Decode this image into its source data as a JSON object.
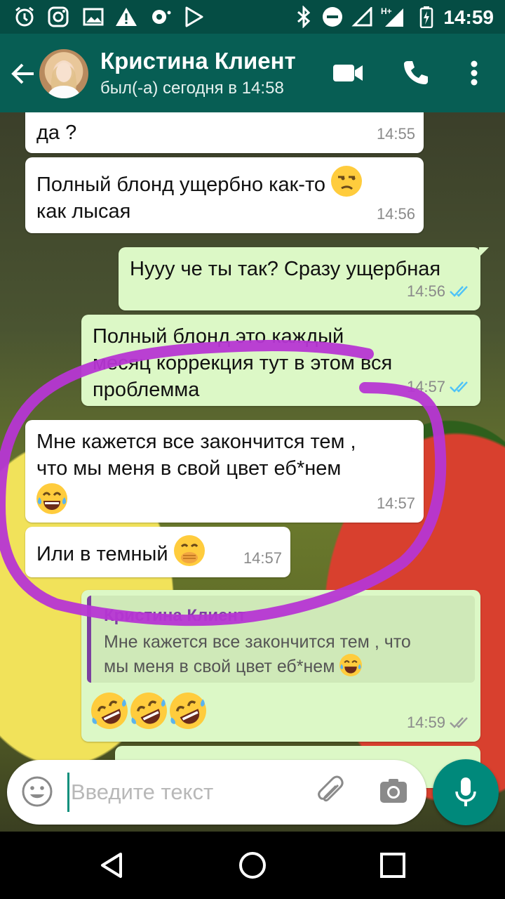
{
  "status_bar": {
    "time": "14:59",
    "network_label": "H+",
    "icons": [
      "alarm-icon",
      "instagram-icon",
      "gallery-icon",
      "warning-icon",
      "sync-icon",
      "play-store-icon",
      "bluetooth-icon",
      "do-not-disturb-icon",
      "signal-icon",
      "battery-icon"
    ]
  },
  "header": {
    "contact_name": "Кристина Клиент",
    "last_seen": "был(-а) сегодня в 14:58",
    "icons": [
      "back-arrow-icon",
      "avatar",
      "video-call-icon",
      "phone-icon",
      "more-vert-icon"
    ]
  },
  "messages": [
    {
      "dir": "in",
      "text": "будут, надо будет несколько раз , да ?",
      "visible_text": "да ?",
      "time": "14:55"
    },
    {
      "dir": "in",
      "text": "Полный блонд ущербно как-то",
      "text2": "как лысая",
      "emoji": "unamused-face",
      "time": "14:56"
    },
    {
      "dir": "out",
      "text": "Нууу че ты так? Сразу ущербная",
      "time": "14:56",
      "ticks": "read"
    },
    {
      "dir": "out",
      "text": "Полный блонд это каждый",
      "text2": "месяц коррекция тут в этом вся",
      "text3": "проблемма",
      "time": "14:57",
      "ticks": "read"
    },
    {
      "dir": "in",
      "text": "Мне кажется все закончится тем ,",
      "text2": "что мы меня в свой цвет еб*нем",
      "emoji": "tears-of-joy",
      "time": "14:57"
    },
    {
      "dir": "in",
      "text": "Или в темный",
      "emoji": "hand-over-mouth",
      "time": "14:57"
    },
    {
      "dir": "out",
      "quoted_author": "Кристина Клиент",
      "quoted_text": "Мне кажется все закончится тем , что",
      "quoted_text2": "мы меня в свой цвет еб*нем",
      "emojis": [
        "rolling-laughing",
        "rolling-laughing",
        "rolling-laughing"
      ],
      "time": "14:59",
      "ticks": "delivered"
    }
  ],
  "composer": {
    "placeholder": "Введите текст",
    "icons": [
      "emoji-icon",
      "attach-icon",
      "camera-icon",
      "mic-icon"
    ]
  },
  "nav_bar": {
    "icons": [
      "back-icon",
      "home-icon",
      "recents-icon"
    ]
  },
  "colors": {
    "app_bar": "#075e54",
    "status_bar": "#054d44",
    "outgoing": "#dcf8c6",
    "incoming": "#ffffff",
    "read_ticks": "#4fc3f7",
    "accent": "#00897b",
    "scribble": "#b636d3"
  }
}
